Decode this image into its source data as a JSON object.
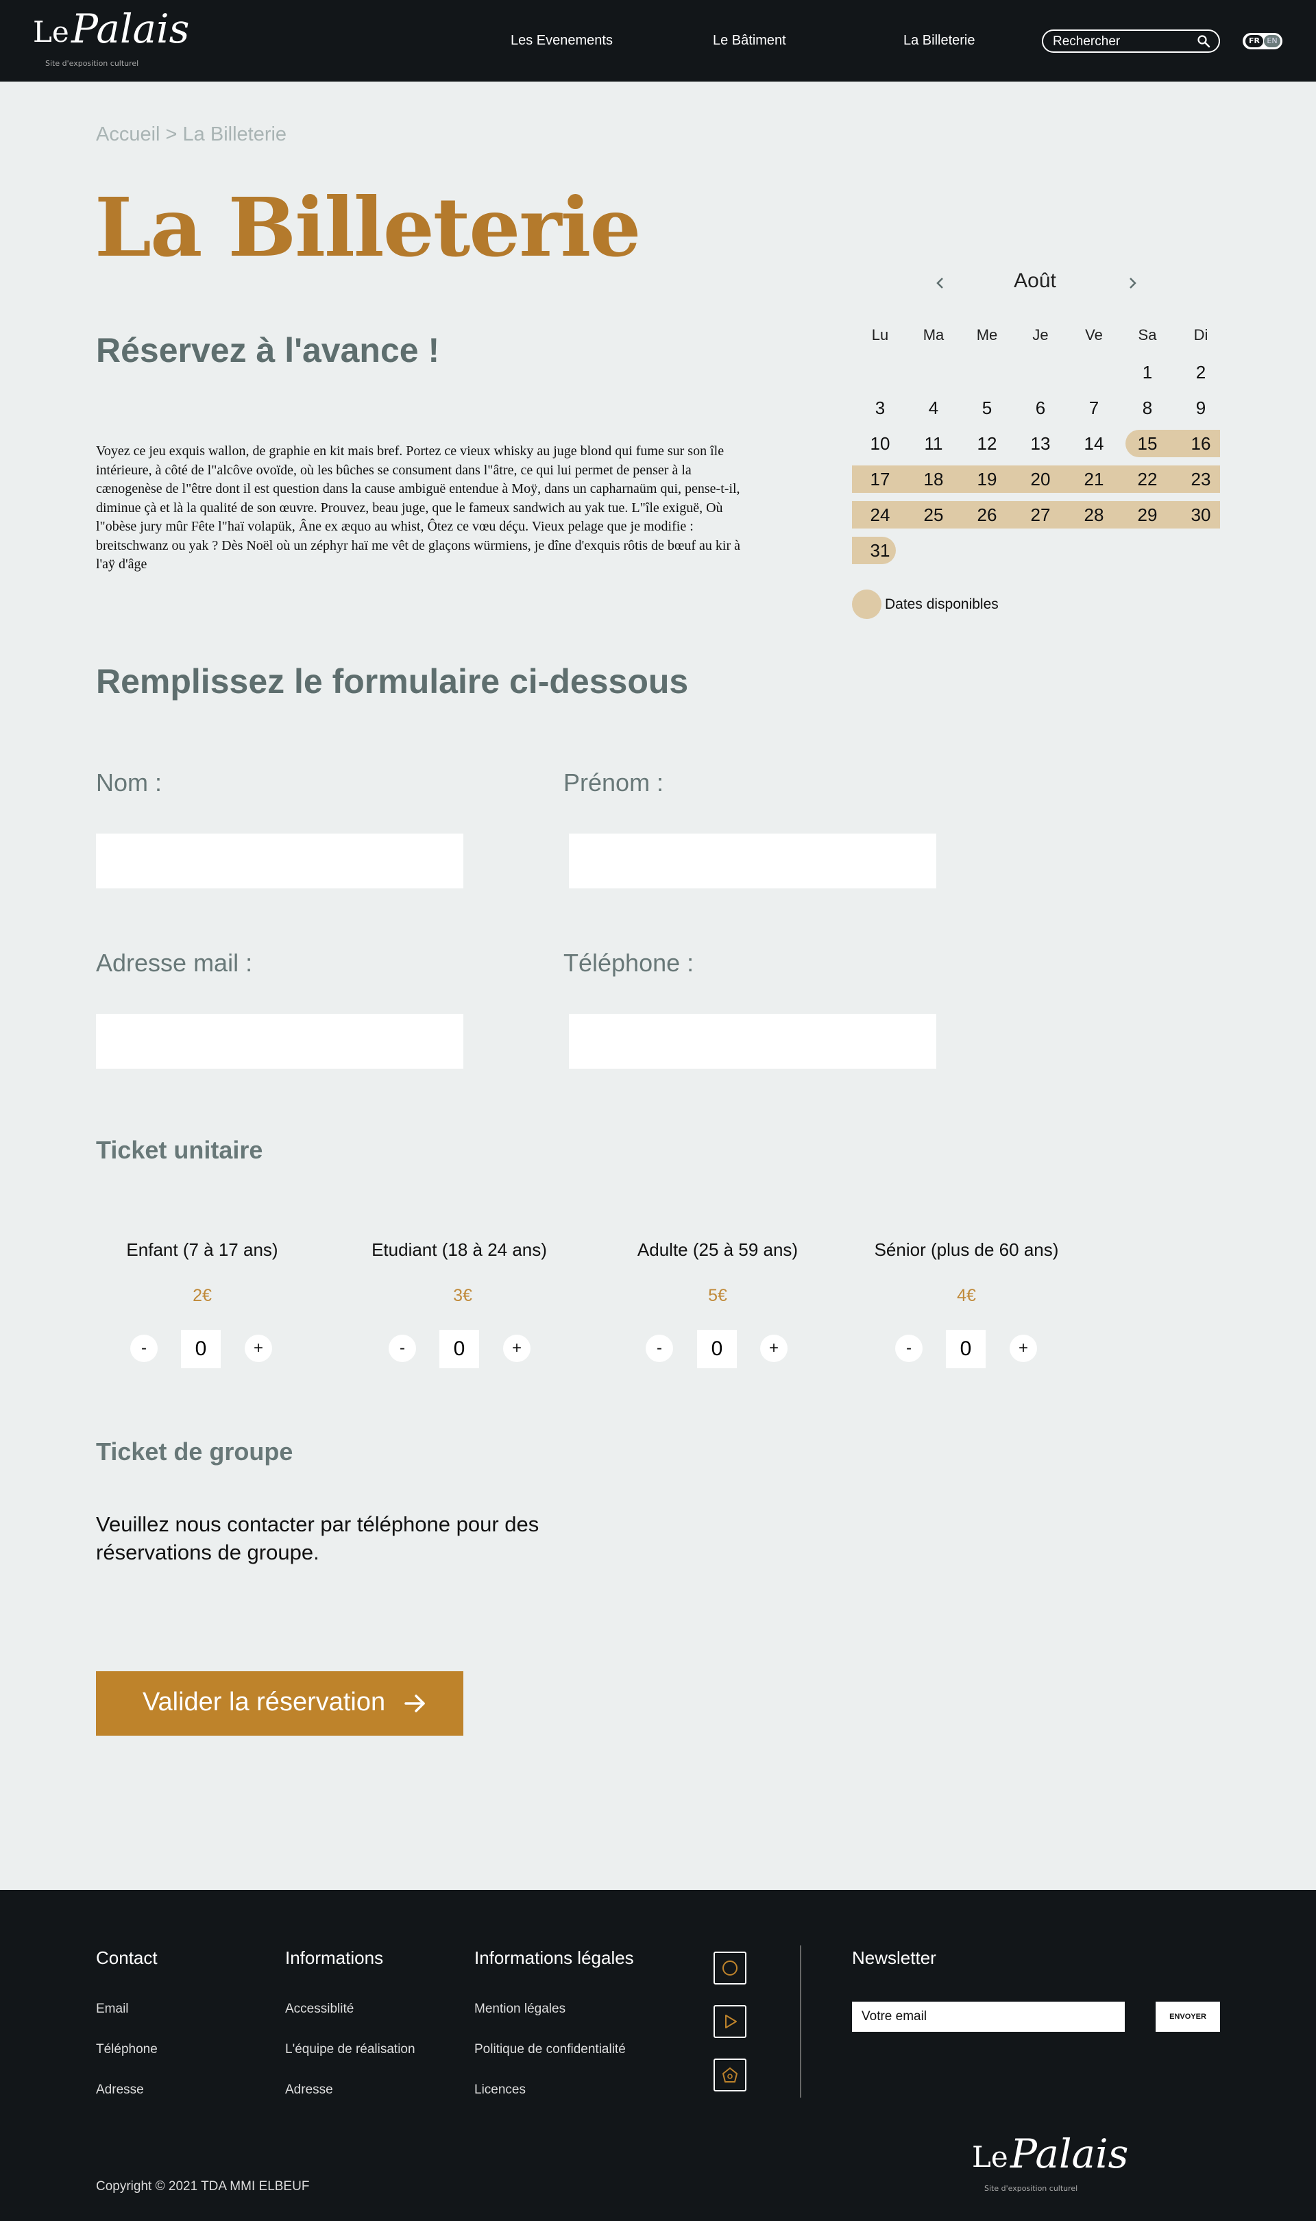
{
  "header": {
    "logo": {
      "le": "Le",
      "palais": "Palais",
      "tagline": "Site d'exposition culturel"
    },
    "nav": [
      "Les Evenements",
      "Le Bâtiment",
      "La Billeterie"
    ],
    "search_placeholder": "Rechercher",
    "lang": {
      "fr": "FR",
      "en": "EN"
    }
  },
  "breadcrumb": "Accueil > La Billeterie",
  "title": "La Billeterie",
  "subtitle": "Réservez à l'avance !",
  "intro": "Voyez ce jeu exquis wallon, de graphie en kit mais bref. Portez ce vieux whisky au juge blond qui fume sur son île intérieure, à côté de l\"alcôve ovoïde, où les bûches se consument dans l\"âtre, ce qui lui permet de penser à la cænogenèse de l\"être dont il est question dans la cause ambiguë entendue à Moÿ, dans un capharnaüm qui, pense-t-il, diminue çà et là la qualité de son œuvre. Prouvez, beau juge, que le fameux sandwich au yak tue. L\"île exiguë, Où l\"obèse jury mûr Fête l\"haï volapük, Âne ex æquo au whist, Ôtez ce vœu déçu. Vieux pelage que je modifie : breitschwanz ou yak ? Dès Noël où un zéphyr haï me vêt de glaçons würmiens, je dîne d'exquis rôtis de bœuf au kir à l'aÿ d'âge",
  "calendar": {
    "month": "Août",
    "weekdays": [
      "Lu",
      "Ma",
      "Me",
      "Je",
      "Ve",
      "Sa",
      "Di"
    ],
    "days": [
      "1",
      "2",
      "3",
      "4",
      "5",
      "6",
      "7",
      "8",
      "9",
      "10",
      "11",
      "12",
      "13",
      "14",
      "15",
      "16",
      "17",
      "18",
      "19",
      "20",
      "21",
      "22",
      "23",
      "24",
      "25",
      "26",
      "27",
      "28",
      "29",
      "30",
      "31"
    ],
    "available_color": "#DECAA6",
    "legend": "Dates disponibles"
  },
  "form": {
    "heading": "Remplissez le formulaire ci-dessous",
    "nom_label": "Nom :",
    "prenom_label": "Prénom :",
    "email_label": "Adresse mail :",
    "phone_label": "Téléphone :",
    "ticket_unit_heading": "Ticket unitaire",
    "tickets": [
      {
        "name": "Enfant (7  à 17 ans)",
        "price": "2€",
        "qty": "0"
      },
      {
        "name": "Etudiant (18 à 24 ans)",
        "price": "3€",
        "qty": "0"
      },
      {
        "name": "Adulte (25 à 59 ans)",
        "price": "5€",
        "qty": "0"
      },
      {
        "name": "Sénior (plus de 60 ans)",
        "price": "4€",
        "qty": "0"
      }
    ],
    "minus": "-",
    "plus": "+",
    "group_heading": "Ticket de groupe",
    "group_text": "Veuillez  nous contacter par téléphone pour des réservations de groupe.",
    "submit": "Valider la réservation"
  },
  "footer": {
    "contact": {
      "title": "Contact",
      "links": [
        "Email",
        "Téléphone",
        "Adresse"
      ]
    },
    "info": {
      "title": "Informations",
      "links": [
        "Accessiblité",
        "L'équipe de réalisation",
        "Adresse"
      ]
    },
    "legal": {
      "title": "Informations légales",
      "links": [
        "Mention légales",
        "Politique de confidentialité",
        "Licences"
      ]
    },
    "newsletter": {
      "title": "Newsletter",
      "placeholder": "Votre email",
      "button": "ENVOYER"
    },
    "copyright": "Copyright © 2021 TDA MMI ELBEUF",
    "social_icons": [
      "instagram-icon",
      "youtube-icon",
      "home-icon"
    ],
    "accent_color": "#BE832B"
  }
}
